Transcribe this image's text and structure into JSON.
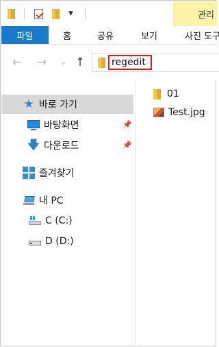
{
  "title_bar": {
    "contextual_tab_label": "관리"
  },
  "ribbon": {
    "tabs": [
      {
        "label": "파일"
      },
      {
        "label": "홈"
      },
      {
        "label": "공유"
      },
      {
        "label": "보기"
      },
      {
        "label": "사진 도구"
      }
    ]
  },
  "navigation": {
    "back_icon": "arrow-left-icon",
    "forward_icon": "arrow-right-icon",
    "recent_icon": "chevron-down-icon",
    "up_icon": "arrow-up-icon"
  },
  "address_bar": {
    "value": "regedit",
    "highlight_color": "#e01919"
  },
  "nav_pane": {
    "quick_access": {
      "label": "바로 가기",
      "icon": "star-icon"
    },
    "pinned": [
      {
        "label": "바탕화면",
        "icon": "desktop-icon"
      },
      {
        "label": "다운로드",
        "icon": "download-icon"
      }
    ],
    "libraries": {
      "label": "즐겨찾기",
      "icon": "libraries-icon"
    },
    "this_pc": {
      "label": "내 PC",
      "icon": "pc-icon"
    },
    "drives": [
      {
        "label": "C (C:)",
        "icon": "drive-c-icon"
      },
      {
        "label": "D (D:)",
        "icon": "drive-d-icon"
      }
    ]
  },
  "content": {
    "items": [
      {
        "name": "01",
        "icon": "folder-icon"
      },
      {
        "name": "Test.jpg",
        "icon": "image-file-icon"
      }
    ]
  },
  "colors": {
    "file_tab": "#1979ca",
    "contextual_tab": "#fdf3a7",
    "selected_nav": "#d9d9d9",
    "folder": "#f3c64f"
  }
}
